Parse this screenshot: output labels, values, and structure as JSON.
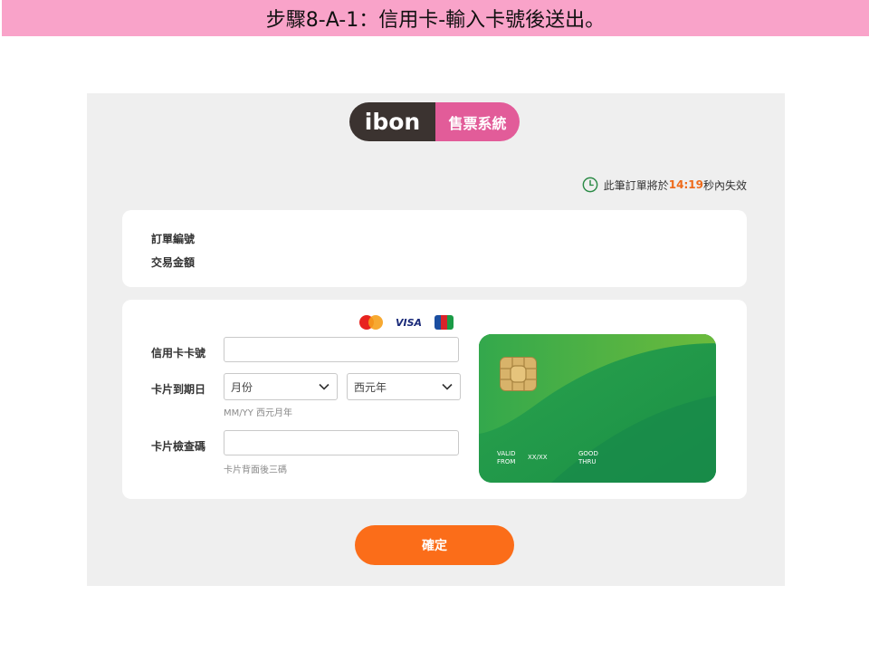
{
  "banner": {
    "title": "步驟8-A-1：信用卡-輸入卡號後送出。"
  },
  "logo": {
    "ibon_text": "ibon",
    "ticket_text": "售票系統"
  },
  "timer": {
    "prefix": "此筆訂單將於",
    "time": "14:19",
    "suffix": "秒內失效"
  },
  "order": {
    "order_number_label": "訂單編號",
    "amount_label": "交易金額"
  },
  "card_brands": {
    "visa": "VISA",
    "jcb": "JCB"
  },
  "form": {
    "card_number_label": "信用卡卡號",
    "expiry_label": "卡片到期日",
    "month_select": "月份",
    "year_select": "西元年",
    "expiry_hint": "MM/YY 西元月年",
    "cvv_label": "卡片檢查碼",
    "cvv_hint": "卡片背面後三碼"
  },
  "card_preview": {
    "valid_from": "VALID\nFROM",
    "from_value": "XX/XX",
    "good_thru": "GOOD\nTHRU"
  },
  "confirm_label": "確定",
  "colors": {
    "banner": "#f9a3c9",
    "accent_orange": "#fb6d19",
    "card_green": "#1f9a4a",
    "timer_green": "#2a8a45"
  }
}
